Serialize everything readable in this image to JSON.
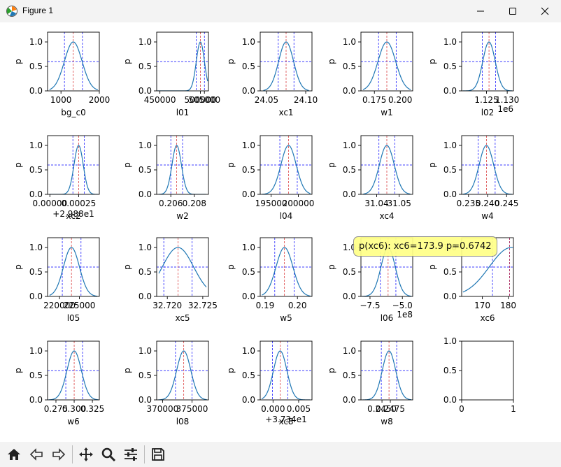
{
  "window": {
    "title": "Figure 1",
    "minimize_icon": "minimize-icon",
    "maximize_icon": "maximize-icon",
    "close_icon": "close-icon"
  },
  "toolbar": {
    "buttons": [
      "home-icon",
      "back-arrow-icon",
      "forward-arrow-icon",
      "pan-move-icon",
      "zoom-magnifier-icon",
      "configure-subplots-icon",
      "save-icon"
    ]
  },
  "tooltip": {
    "text": "p(xc6): xc6=173.9  p=0.6742"
  },
  "colors": {
    "curve": "#1f77b4",
    "median": "#d62728",
    "bounds": "#0000ff",
    "tooltip_bg": "#ffff88"
  },
  "chart_data": [
    {
      "type": "line",
      "xlabel": "bg_c0",
      "ylabel": "p",
      "xlim": [
        650,
        2000
      ],
      "ylim": [
        0,
        1.2
      ],
      "xticks": [
        1000,
        2000
      ],
      "xtick_labels": [
        "1000",
        "2000"
      ],
      "yticks": [
        0,
        0.5,
        1
      ],
      "ytick_labels": [
        "0.0",
        "0.5",
        "1.0"
      ],
      "mu": 1320,
      "sigma": 230,
      "median": 1320,
      "lower": 1090,
      "upper": 1560,
      "hline": 0.6,
      "xrange": [
        700,
        1960
      ],
      "offset_text": ""
    },
    {
      "type": "line",
      "xlabel": "l01",
      "ylabel": "p",
      "xlim": [
        446000,
        510000
      ],
      "ylim": [
        0,
        1.2
      ],
      "xticks": [
        450000,
        500000,
        505000
      ],
      "xtick_labels": [
        "450000",
        "500000",
        "505000"
      ],
      "yticks": [
        0,
        0.5,
        1
      ],
      "ytick_labels": [
        "0.0",
        "0.5",
        "1.0"
      ],
      "mu": 500000,
      "sigma": 5000,
      "median": 500000,
      "lower": 495000,
      "upper": 505000,
      "hline": 0.6,
      "xrange": [
        447000,
        509000
      ],
      "offset_text": ""
    },
    {
      "type": "line",
      "xlabel": "xc1",
      "ylabel": "p",
      "xlim": [
        24.042,
        24.108
      ],
      "ylim": [
        0,
        1.2
      ],
      "xticks": [
        24.05,
        24.1
      ],
      "xtick_labels": [
        "24.05",
        "24.10"
      ],
      "yticks": [
        0,
        0.5,
        1
      ],
      "ytick_labels": [
        "0.0",
        "0.5",
        "1.0"
      ],
      "mu": 24.075,
      "sigma": 0.0095,
      "median": 24.075,
      "lower": 24.065,
      "upper": 24.085,
      "hline": 0.6,
      "xrange": [
        24.046,
        24.104
      ],
      "offset_text": ""
    },
    {
      "type": "line",
      "xlabel": "w1",
      "ylabel": "p",
      "xlim": [
        0.162,
        0.212
      ],
      "ylim": [
        0,
        1.2
      ],
      "xticks": [
        0.175,
        0.2
      ],
      "xtick_labels": [
        "0.175",
        "0.200"
      ],
      "yticks": [
        0,
        0.5,
        1
      ],
      "ytick_labels": [
        "0.0",
        "0.5",
        "1.0"
      ],
      "mu": 0.187,
      "sigma": 0.0085,
      "median": 0.187,
      "lower": 0.179,
      "upper": 0.196,
      "hline": 0.6,
      "xrange": [
        0.164,
        0.21
      ],
      "offset_text": ""
    },
    {
      "type": "line",
      "xlabel": "l02",
      "ylabel": "p",
      "xlim": [
        1119000,
        1131500
      ],
      "ylim": [
        0,
        1.2
      ],
      "xticks": [
        1125000,
        1130000
      ],
      "xtick_labels": [
        "1.125",
        "1.130"
      ],
      "yticks": [
        0,
        0.5,
        1
      ],
      "ytick_labels": [
        "0.0",
        "0.5",
        "1.0"
      ],
      "mu": 1125600,
      "sigma": 1500,
      "median": 1125600,
      "lower": 1124000,
      "upper": 1127200,
      "hline": 0.6,
      "xrange": [
        1119300,
        1131200
      ],
      "offset_text": "1e6"
    },
    {
      "type": "line",
      "xlabel": "xc2",
      "ylabel": "p",
      "xlim": [
        -2e-05,
        0.00043
      ],
      "ylim": [
        0,
        1.2
      ],
      "xticks": [
        0,
        0.00025
      ],
      "xtick_labels": [
        "0.00000",
        "0.00025"
      ],
      "yticks": [
        0,
        0.5,
        1
      ],
      "ytick_labels": [
        "0.0",
        "0.5",
        "1.0"
      ],
      "mu": 0.00025,
      "sigma": 4e-05,
      "median": 0.00025,
      "lower": 0.0002,
      "upper": 0.0003,
      "hline": 0.6,
      "xrange": [
        0,
        0.00042
      ],
      "offset_text": "+2.988e1"
    },
    {
      "type": "line",
      "xlabel": "w2",
      "ylabel": "p",
      "xlim": [
        0.2048,
        0.2092
      ],
      "ylim": [
        0,
        1.2
      ],
      "xticks": [
        0.206,
        0.208
      ],
      "xtick_labels": [
        "0.206",
        "0.208"
      ],
      "yticks": [
        0,
        0.5,
        1
      ],
      "ytick_labels": [
        "0.0",
        "0.5",
        "1.0"
      ],
      "mu": 0.2065,
      "sigma": 0.0004,
      "median": 0.2065,
      "lower": 0.206,
      "upper": 0.207,
      "hline": 0.6,
      "xrange": [
        0.205,
        0.209
      ],
      "offset_text": ""
    },
    {
      "type": "line",
      "xlabel": "l04",
      "ylabel": "p",
      "xlim": [
        193000,
        202500
      ],
      "ylim": [
        0,
        1.2
      ],
      "xticks": [
        195000,
        200000
      ],
      "xtick_labels": [
        "195000",
        "200000"
      ],
      "yticks": [
        0,
        0.5,
        1
      ],
      "ytick_labels": [
        "0.0",
        "0.5",
        "1.0"
      ],
      "mu": 198200,
      "sigma": 1400,
      "median": 198200,
      "lower": 196600,
      "upper": 199800,
      "hline": 0.6,
      "xrange": [
        193300,
        202200
      ],
      "offset_text": ""
    },
    {
      "type": "line",
      "xlabel": "xc4",
      "ylabel": "p",
      "xlim": [
        31.033,
        31.056
      ],
      "ylim": [
        0,
        1.2
      ],
      "xticks": [
        31.04,
        31.05
      ],
      "xtick_labels": [
        "31.04",
        "31.05"
      ],
      "yticks": [
        0,
        0.5,
        1
      ],
      "ytick_labels": [
        "0.0",
        "0.5",
        "1.0"
      ],
      "mu": 31.0445,
      "sigma": 0.0033,
      "median": 31.0445,
      "lower": 31.041,
      "upper": 31.048,
      "hline": 0.6,
      "xrange": [
        31.034,
        31.055
      ],
      "offset_text": ""
    },
    {
      "type": "line",
      "xlabel": "w4",
      "ylabel": "p",
      "xlim": [
        0.2332,
        0.2468
      ],
      "ylim": [
        0,
        1.2
      ],
      "xticks": [
        0.235,
        0.24,
        0.245
      ],
      "xtick_labels": [
        "0.235",
        "0.240",
        "0.245"
      ],
      "yticks": [
        0,
        0.5,
        1
      ],
      "ytick_labels": [
        "0.0",
        "0.5",
        "1.0"
      ],
      "mu": 0.2397,
      "sigma": 0.0019,
      "median": 0.2397,
      "lower": 0.2375,
      "upper": 0.242,
      "hline": 0.6,
      "xrange": [
        0.2335,
        0.2465
      ],
      "offset_text": ""
    },
    {
      "type": "line",
      "xlabel": "l05",
      "ylabel": "p",
      "xlim": [
        217000,
        230000
      ],
      "ylim": [
        0,
        1.2
      ],
      "xticks": [
        220000,
        225000
      ],
      "xtick_labels": [
        "220000",
        "225000"
      ],
      "yticks": [
        0,
        0.5,
        1
      ],
      "ytick_labels": [
        "0.0",
        "0.5",
        "1.0"
      ],
      "mu": 223000,
      "sigma": 2000,
      "median": 223000,
      "lower": 220700,
      "upper": 225400,
      "hline": 0.6,
      "xrange": [
        217500,
        229500
      ],
      "offset_text": ""
    },
    {
      "type": "line",
      "xlabel": "xc5",
      "ylabel": "p",
      "xlim": [
        32.7185,
        32.7258
      ],
      "ylim": [
        0,
        1.2
      ],
      "xticks": [
        32.72,
        32.725
      ],
      "xtick_labels": [
        "32.720",
        "32.725"
      ],
      "yticks": [
        0,
        0.5,
        1
      ],
      "ytick_labels": [
        "0.0",
        "0.5",
        "1.0"
      ],
      "mu": 32.7215,
      "sigma": 0.0022,
      "median": 32.7215,
      "lower": 32.7195,
      "upper": 32.7235,
      "hline": 0.6,
      "xrange": [
        32.7188,
        32.7255
      ],
      "offset_text": ""
    },
    {
      "type": "line",
      "xlabel": "w5",
      "ylabel": "p",
      "xlim": [
        0.1885,
        0.2045
      ],
      "ylim": [
        0,
        1.2
      ],
      "xticks": [
        0.19,
        0.2
      ],
      "xtick_labels": [
        "0.19",
        "0.20"
      ],
      "yticks": [
        0,
        0.5,
        1
      ],
      "ytick_labels": [
        "0.0",
        "0.5",
        "1.0"
      ],
      "mu": 0.196,
      "sigma": 0.0026,
      "median": 0.196,
      "lower": 0.193,
      "upper": 0.199,
      "hline": 0.6,
      "xrange": [
        0.189,
        0.204
      ],
      "offset_text": ""
    },
    {
      "type": "line",
      "xlabel": "l06",
      "ylabel": "p",
      "xlim": [
        -820000000.0,
        -420000000.0
      ],
      "ylim": [
        0,
        1.2
      ],
      "xticks": [
        -750000000.0,
        -500000000.0
      ],
      "xtick_labels": [
        "−7.5",
        "−5.0"
      ],
      "yticks": [
        0,
        0.5,
        1
      ],
      "ytick_labels": [
        "0.0",
        "0.5",
        "1.0"
      ],
      "mu": -610000000.0,
      "sigma": 55000000.0,
      "median": -610000000.0,
      "lower": -670000000.0,
      "upper": -550000000.0,
      "hline": 0.6,
      "xrange": [
        -810000000.0,
        -430000000.0
      ],
      "offset_text": "1e8"
    },
    {
      "type": "line",
      "xlabel": "xc6",
      "ylabel": "p",
      "xlim": [
        162,
        182
      ],
      "ylim": [
        0,
        1.2
      ],
      "xticks": [
        170,
        180
      ],
      "xtick_labels": [
        "170",
        "180"
      ],
      "yticks": [
        0,
        0.5,
        1
      ],
      "ytick_labels": [
        "0.0",
        "0.5",
        "1.0"
      ],
      "mu": 181.2,
      "sigma": 8.5,
      "median": 180.5,
      "lower": 173.9,
      "upper": 180.5,
      "hline": 0.6,
      "xrange": [
        162.5,
        181.8
      ],
      "offset_text": ""
    },
    {
      "type": "line",
      "xlabel": "w6",
      "ylabel": "p",
      "xlim": [
        0.2635,
        0.3345
      ],
      "ylim": [
        0,
        1.2
      ],
      "xticks": [
        0.275,
        0.3,
        0.325
      ],
      "xtick_labels": [
        "0.275",
        "0.300",
        "0.325"
      ],
      "yticks": [
        0,
        0.5,
        1
      ],
      "ytick_labels": [
        "0.0",
        "0.5",
        "1.0"
      ],
      "mu": 0.3,
      "sigma": 0.0098,
      "median": 0.3,
      "lower": 0.2885,
      "upper": 0.3115,
      "hline": 0.6,
      "xrange": [
        0.265,
        0.333
      ],
      "offset_text": ""
    },
    {
      "type": "line",
      "xlabel": "l08",
      "ylabel": "p",
      "xlim": [
        369000,
        377800
      ],
      "ylim": [
        0,
        1.2
      ],
      "xticks": [
        370000,
        375000
      ],
      "xtick_labels": [
        "370000",
        "375000"
      ],
      "yticks": [
        0,
        0.5,
        1
      ],
      "ytick_labels": [
        "0.0",
        "0.5",
        "1.0"
      ],
      "mu": 373600,
      "sigma": 1200,
      "median": 373600,
      "lower": 372200,
      "upper": 375000,
      "hline": 0.6,
      "xrange": [
        369300,
        377500
      ],
      "offset_text": ""
    },
    {
      "type": "line",
      "xlabel": "xc8",
      "ylabel": "p",
      "xlim": [
        -0.0025,
        0.0076
      ],
      "ylim": [
        0,
        1.2
      ],
      "xticks": [
        0,
        0.005
      ],
      "xtick_labels": [
        "0.000",
        "0.005"
      ],
      "yticks": [
        0,
        0.5,
        1
      ],
      "ytick_labels": [
        "0.0",
        "0.5",
        "1.0"
      ],
      "mu": 0.0014,
      "sigma": 0.0013,
      "median": 0.0014,
      "lower": -0.0001,
      "upper": 0.0029,
      "hline": 0.6,
      "xrange": [
        -0.0022,
        0.0072
      ],
      "offset_text": "+3.734e1"
    },
    {
      "type": "line",
      "xlabel": "w8",
      "ylabel": "p",
      "xlim": [
        0.2387,
        0.2542
      ],
      "ylim": [
        0,
        1.2
      ],
      "xticks": [
        0.245,
        0.2475
      ],
      "xtick_labels": [
        "0.2450",
        "0.2475"
      ],
      "yticks": [
        0,
        0.5,
        1
      ],
      "ytick_labels": [
        "0.0",
        "0.5",
        "1.0"
      ],
      "mu": 0.2471,
      "sigma": 0.002,
      "median": 0.2471,
      "lower": 0.2448,
      "upper": 0.2494,
      "hline": 0.6,
      "xrange": [
        0.2392,
        0.2538
      ],
      "offset_text": ""
    },
    {
      "type": "empty",
      "xlabel": "",
      "ylabel": "",
      "xlim": [
        0,
        1
      ],
      "ylim": [
        0,
        1
      ],
      "xticks": [
        0,
        1
      ],
      "xtick_labels": [
        "0",
        "1"
      ],
      "yticks": [
        0,
        0.5,
        1
      ],
      "ytick_labels": [
        "0.0",
        "0.5",
        "1.0"
      ],
      "offset_text": ""
    }
  ]
}
